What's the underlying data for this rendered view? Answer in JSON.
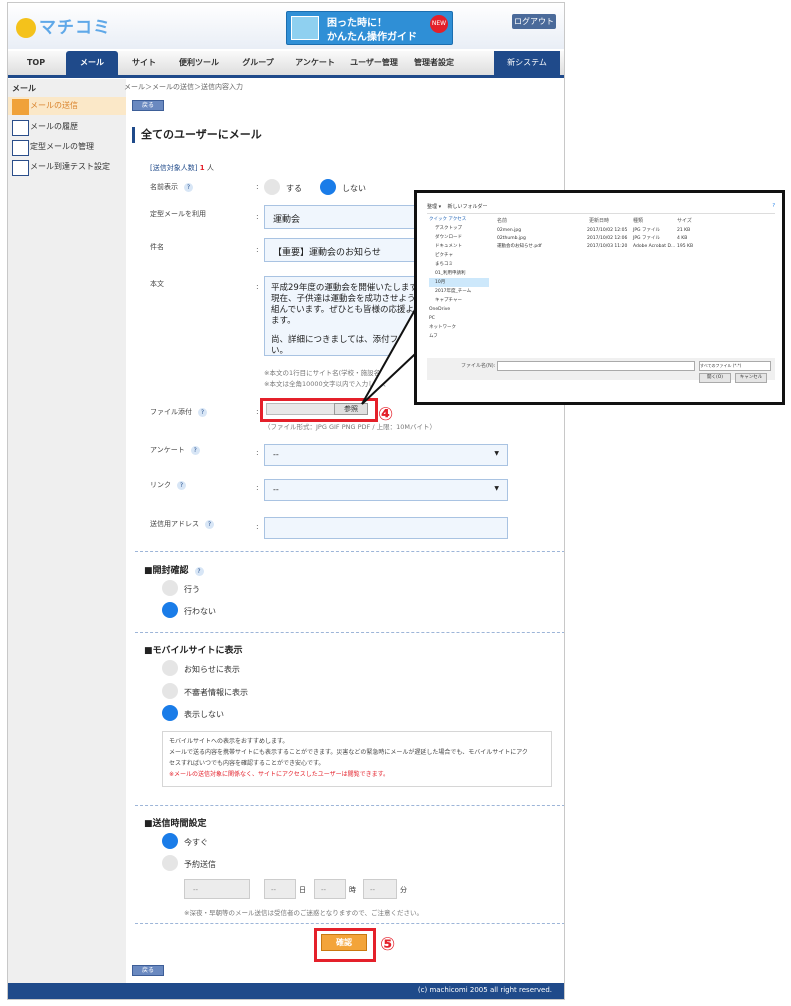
{
  "header": {
    "logo_text": "マチコミ",
    "banner_line1": "困った時に！",
    "banner_line2": "かんたん操作ガイド",
    "banner_badge": "NEW",
    "logout_label": "ログアウト"
  },
  "nav": {
    "items": [
      "TOP",
      "メール",
      "サイト",
      "便利ツール",
      "グループ",
      "アンケート",
      "ユーザー管理",
      "管理者設定"
    ],
    "system_label": "新システム"
  },
  "sidebar": {
    "heading": "メール",
    "items": [
      "メールの送信",
      "メールの履歴",
      "定型メールの管理",
      "メール到達テスト設定"
    ]
  },
  "breadcrumb": "メール＞メールの送信＞送信内容入力",
  "back_label": "戻る",
  "page_title": "全てのユーザーにメール",
  "recipients": {
    "label": "[送信対象人数]",
    "count": "1",
    "unit": "人"
  },
  "form": {
    "name_display": {
      "label": "名前表示",
      "opt_yes": "する",
      "opt_no": "しない"
    },
    "template": {
      "label": "定型メールを利用",
      "value": "運動会"
    },
    "subject": {
      "label": "件名",
      "value": "【重要】運動会のお知らせ"
    },
    "body": {
      "label": "本文",
      "line1": "平成29年度の運動会を開催いたします",
      "line2": "現在、子供達は運動会を成功させよう",
      "line3": "組んでいます。ぜひとも皆様の応援よ",
      "line4": "ます。",
      "line5": "尚、詳細につきましては、添付ファ",
      "line6": "い。",
      "note1": "※本文の1行目にサイト名(学校・施設名)が",
      "note2": "※本文は全角10000文字以内で入力してく"
    },
    "attachment": {
      "label": "ファイル添付",
      "browse_label": "参照",
      "note": "（ファイル形式：JPG GIF PNG PDF / 上限：10Mバイト）"
    },
    "survey": {
      "label": "アンケート",
      "value": "--"
    },
    "link": {
      "label": "リンク",
      "value": "--"
    },
    "sender": {
      "label": "送信用アドレス",
      "value": ""
    }
  },
  "open_confirm": {
    "title": "■開封確認",
    "opt1": "行う",
    "opt2": "行わない"
  },
  "mobile": {
    "title": "■モバイルサイトに表示",
    "opt1": "お知らせに表示",
    "opt2": "不審者情報に表示",
    "opt3": "表示しない",
    "info1": "モバイルサイトへの表示をおすすめします。",
    "info2": "メールで送る内容を携帯サイトにも表示することができます。災害などの緊急時にメールが遅延した場合でも、モバイルサイトにアク",
    "info3": "セスすればいつでも内容を確認することができ安心です。",
    "info4": "※メールの送信対象に関係なく、サイトにアクセスしたユーザーは閲覧できます。"
  },
  "send_time": {
    "title": "■送信時間設定",
    "opt1": "今すぐ",
    "opt2": "予約送信",
    "placeholder": "--",
    "day": "日",
    "hour": "時",
    "minute": "分",
    "note": "※深夜・早朝等のメール送信は受信者のご迷惑となりますので、ご注意ください。"
  },
  "confirm_label": "確認",
  "callouts": {
    "step4": "④",
    "step5": "⑤"
  },
  "footer": "(c) machicomi 2005 all right reserved.",
  "dialog": {
    "toolbar_org": "整理 ▾",
    "toolbar_new": "新しいフォルダー",
    "col_name": "名前",
    "col_date": "更新日時",
    "col_type": "種類",
    "col_size": "サイズ",
    "tree": [
      "クイック アクセス",
      "デスクトップ",
      "ダウンロード",
      "ドキュメント",
      "ピクチャ",
      "まちコミ",
      "01_利用申請利",
      "10月",
      "2017年度_チーム",
      "キャプチャー",
      "OneDrive",
      "PC",
      "ネットワーク",
      "ムフ"
    ],
    "files": [
      {
        "name": "02men.jpg",
        "date": "2017/10/02 12:05",
        "type": "JPG ファイル",
        "size": "21 KB"
      },
      {
        "name": "02thumb.jpg",
        "date": "2017/10/02 12:06",
        "type": "JPG ファイル",
        "size": "4 KB"
      },
      {
        "name": "運動会のお知らせ.pdf",
        "date": "2017/10/03 11:20",
        "type": "Adobe Acrobat D...",
        "size": "195 KB"
      }
    ],
    "filename_label": "ファイル名(N):",
    "filetype": "すべてのファイル (*.*)",
    "open_label": "開く(O)",
    "cancel_label": "キャンセル"
  }
}
